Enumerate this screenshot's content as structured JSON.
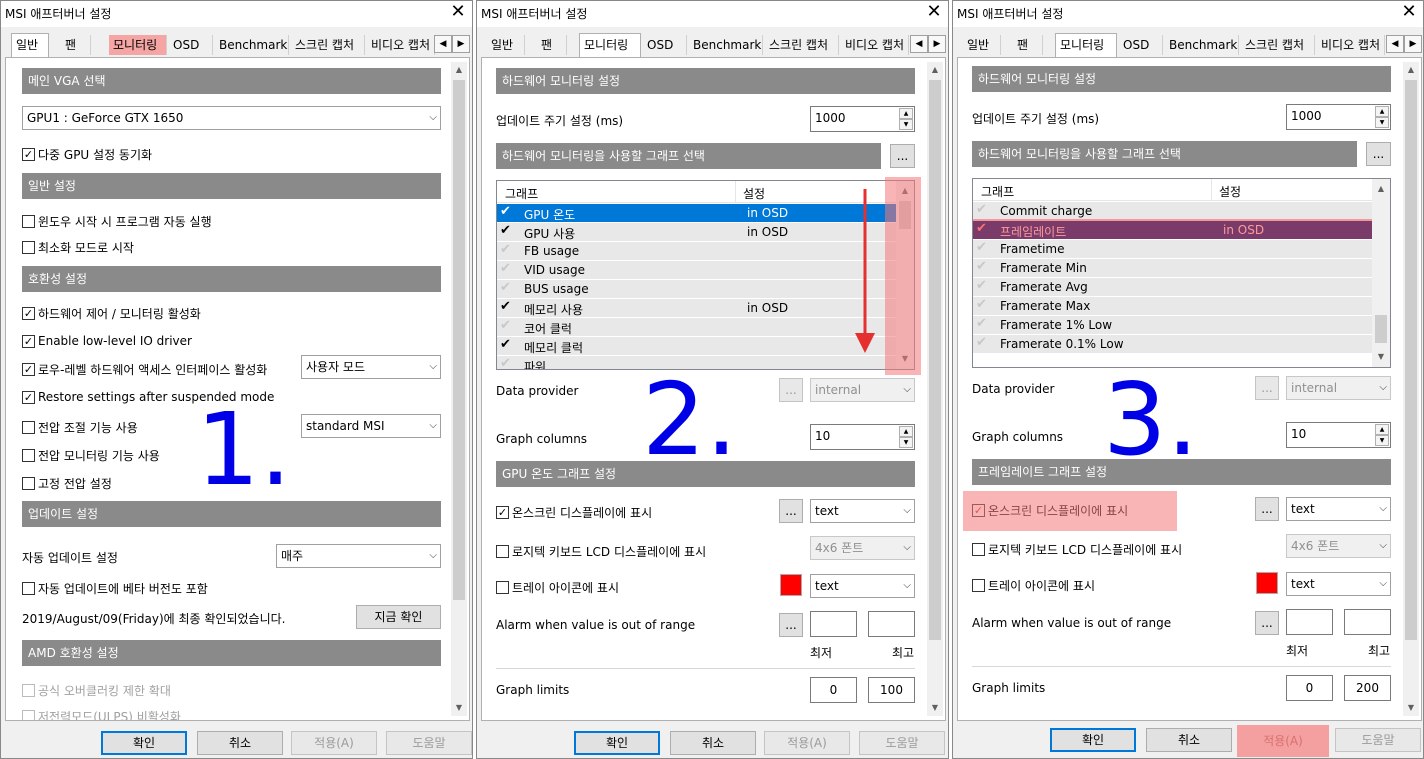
{
  "window_title": "MSI 애프터버너 설정",
  "tabs": [
    "일반",
    "팬",
    "모니터링",
    "OSD",
    "Benchmark",
    "스크린 캡처",
    "비디오 캡처"
  ],
  "buttons": {
    "ok": "확인",
    "cancel": "취소",
    "apply": "적용(A)",
    "help": "도움말"
  },
  "annotations": {
    "n1": "1.",
    "n2": "2.",
    "n3": "3."
  },
  "general": {
    "sec_vga": "메인 VGA 선택",
    "gpu_select": "GPU1 : GeForce GTX 1650",
    "sync_multi_gpu": "다중 GPU 설정 동기화",
    "sec_general": "일반 설정",
    "autostart": "윈도우 시작 시 프로그램 자동 실행",
    "start_minimized": "최소화 모드로 시작",
    "sec_compat": "호환성 설정",
    "hw_control": "하드웨어 제어 / 모니터링 활성화",
    "low_level_io": "Enable low-level IO driver",
    "low_level_hw": "로우-레벨 하드웨어 액세스 인터페이스 활성화",
    "user_mode": "사용자 모드",
    "restore_settings": "Restore settings after suspended mode",
    "voltage_control": "전압 조절 기능 사용",
    "standard_msi": "standard MSI",
    "voltage_monitor": "전압 모니터링 기능 사용",
    "fixed_voltage": "고정 전압 설정",
    "sec_update": "업데이트 설정",
    "auto_update": "자동 업데이트 설정",
    "weekly": "매주",
    "include_beta": "자동 업데이트에 베타 버전도 포함",
    "last_checked": "2019/August/09(Friday)에 최종 확인되었습니다.",
    "check_now": "지금 확인",
    "sec_amd": "AMD 호환성 설정",
    "official_oc": "공식 오버클러킹 제한 확대",
    "ulps": "저전력모드(ULPS) 비활성화"
  },
  "monitoring": {
    "sec_hw": "하드웨어 모니터링 설정",
    "update_period": "업데이트 주기 설정 (ms)",
    "update_value": "1000",
    "sec_graph_select": "하드웨어 모니터링을 사용할 그래프 선택",
    "col_graph": "그래프",
    "col_setting": "설정",
    "rows2": [
      {
        "name": "GPU 온도",
        "state": "in OSD",
        "on": true
      },
      {
        "name": "GPU 사용",
        "state": "in OSD",
        "on": true
      },
      {
        "name": "FB usage",
        "state": "",
        "on": false
      },
      {
        "name": "VID usage",
        "state": "",
        "on": false
      },
      {
        "name": "BUS usage",
        "state": "",
        "on": false
      },
      {
        "name": "메모리 사용",
        "state": "in OSD",
        "on": true
      },
      {
        "name": "코어 클럭",
        "state": "",
        "on": false
      },
      {
        "name": "메모리 클럭",
        "state": "",
        "on": true
      },
      {
        "name": "파워",
        "state": "",
        "on": false
      }
    ],
    "rows3": [
      {
        "name": "Commit charge",
        "state": "",
        "on": false
      },
      {
        "name": "프레임레이트",
        "state": "in OSD",
        "on": true
      },
      {
        "name": "Frametime",
        "state": "",
        "on": false
      },
      {
        "name": "Framerate Min",
        "state": "",
        "on": false
      },
      {
        "name": "Framerate Avg",
        "state": "",
        "on": false
      },
      {
        "name": "Framerate Max",
        "state": "",
        "on": false
      },
      {
        "name": "Framerate 1% Low",
        "state": "",
        "on": false
      },
      {
        "name": "Framerate 0.1% Low",
        "state": "",
        "on": false
      }
    ],
    "data_provider": "Data provider",
    "internal": "internal",
    "graph_columns": "Graph columns",
    "columns_value": "10",
    "sec_gpu_temp": "GPU 온도 그래프 설정",
    "sec_framerate": "프레임레이트 그래프 설정",
    "osd_show": "온스크린 디스플레이에 표시",
    "text": "text",
    "logitech_lcd": "로지텍 키보드 LCD 디스플레이에 표시",
    "font_4x6": "4x6 폰트",
    "tray_icon": "트레이 아이콘에 표시",
    "alarm": "Alarm when value is out of range",
    "min": "최저",
    "max": "최고",
    "graph_limits": "Graph limits",
    "limit_min": "0",
    "limit_max2": "100",
    "limit_max3": "200",
    "dots": "..."
  }
}
